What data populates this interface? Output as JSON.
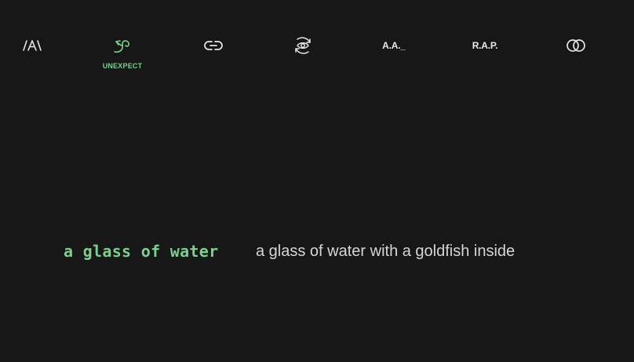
{
  "toolbar": {
    "tools": [
      {
        "icon": "letter-spacing-icon",
        "text": "/A\\"
      },
      {
        "icon": "unexpect-icon",
        "label": "UNEXPECT",
        "active": true
      },
      {
        "icon": "link-icon"
      },
      {
        "icon": "eye-rotate-icon"
      },
      {
        "icon": "acronym-icon",
        "text": "A.A._"
      },
      {
        "icon": "rap-icon",
        "text": "R.A.P."
      },
      {
        "icon": "overlap-circles-icon"
      }
    ]
  },
  "prompt": {
    "input": "a glass of water",
    "output": "a glass of water with a goldfish inside"
  },
  "colors": {
    "background": "#171717",
    "accent": "#7ccf8e",
    "text": "#d6d6d6"
  }
}
